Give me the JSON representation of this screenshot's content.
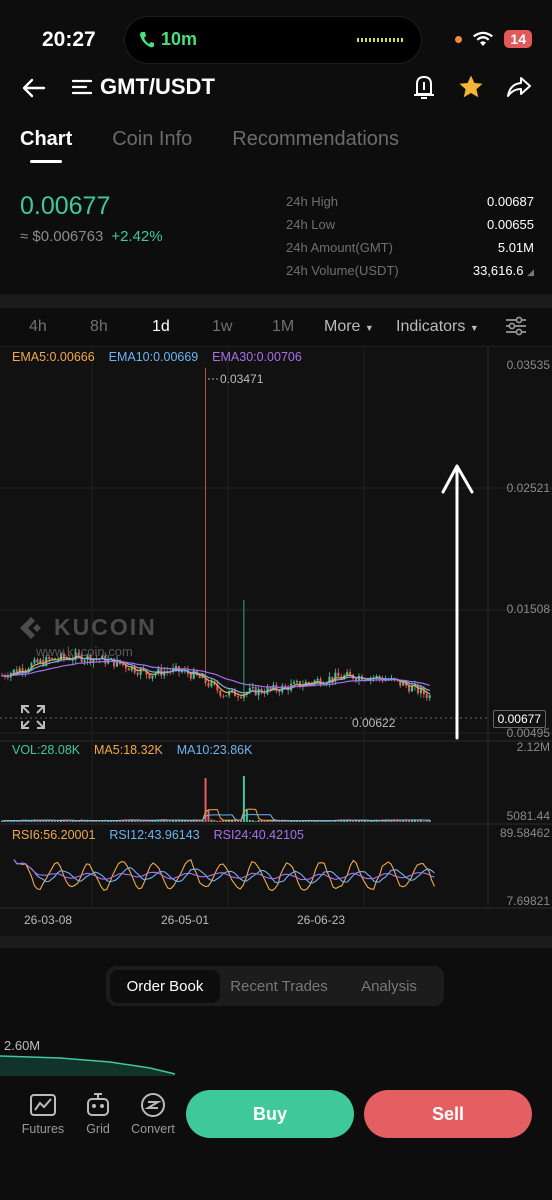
{
  "status": {
    "time": "20:27",
    "call_duration": "10m",
    "battery": "14"
  },
  "header": {
    "pair": "GMT/USDT"
  },
  "tabs": [
    "Chart",
    "Coin Info",
    "Recommendations"
  ],
  "price": {
    "last": "0.00677",
    "usd": "≈ $0.006763",
    "change": "+2.42%"
  },
  "stats": [
    {
      "label": "24h High",
      "value": "0.00687"
    },
    {
      "label": "24h Low",
      "value": "0.00655"
    },
    {
      "label": "24h Amount(GMT)",
      "value": "5.01M"
    },
    {
      "label": "24h Volume(USDT)",
      "value": "33,616.6"
    }
  ],
  "intervals": [
    "4h",
    "8h",
    "1d",
    "1w",
    "1M"
  ],
  "interval_more": "More",
  "interval_indicators": "Indicators",
  "chart": {
    "ema5": "EMA5:0.00666",
    "ema10": "EMA10:0.00669",
    "ema30": "EMA30:0.00706",
    "y_labels": [
      "0.03535",
      "0.02521",
      "0.01508",
      "0.00495"
    ],
    "high_marker": "0.03471",
    "low_marker": "0.00622",
    "last_price": "0.00677",
    "watermark": "KUCOIN",
    "watermark_url": "www.kucoin.com",
    "vol": "VOL:28.08K",
    "vol_ma5": "MA5:18.32K",
    "vol_ma10": "MA10:23.86K",
    "vol_max": "2.12M",
    "vol_min": "5081.44",
    "rsi6": "RSI6:56.20001",
    "rsi12": "RSI12:43.96143",
    "rsi24": "RSI24:40.42105",
    "rsi_max": "89.58462",
    "rsi_min": "7.69821",
    "x_labels": [
      "26-03-08",
      "26-05-01",
      "26-06-23"
    ],
    "colors": {
      "ema5": "#f0a94b",
      "ema10": "#6db3f2",
      "ema30": "#a871e8",
      "up": "#3fc99a",
      "down": "#e35f61"
    }
  },
  "bottom": {
    "tabs": [
      "Order Book",
      "Recent Trades",
      "Analysis"
    ],
    "depth_label": "2.60M",
    "nav": [
      "Futures",
      "Grid",
      "Convert"
    ],
    "buy": "Buy",
    "sell": "Sell"
  }
}
